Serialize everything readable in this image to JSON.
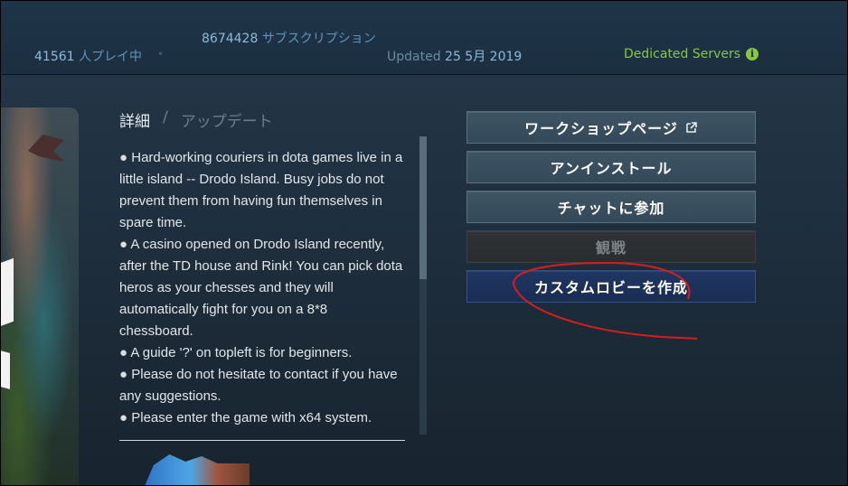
{
  "stats": {
    "players_count": "41561",
    "players_label": "人プレイ中",
    "separator": "•",
    "subscriptions_count": "8674428",
    "subscriptions_label": "サブスクリプション",
    "updated_label": "Updated",
    "updated_date": "25 5月 2019",
    "dedicated_servers": "Dedicated Servers",
    "info_glyph": "i"
  },
  "tabs": {
    "details": "詳細",
    "separator": "/",
    "updates": "アップデート"
  },
  "description": {
    "bullet": "●",
    "lines": [
      "Hard-working couriers in dota games live in a little island -- Drodo Island. Busy jobs do not prevent them from having fun themselves in spare time.",
      "A casino opened on Drodo Island recently, after the TD house and Rink! You can pick dota heros as your chesses and they will automatically fight for you on a 8*8 chessboard.",
      "A guide '?' on topleft is for beginners.",
      "Please do not hesitate to contact if you have any suggestions.",
      "Please enter the game with x64 system."
    ]
  },
  "buttons": {
    "workshop": "ワークショップページ",
    "uninstall": "アンインストール",
    "join_chat": "チャットに参加",
    "watch": "観戦",
    "create_lobby": "カスタムロビーを作成"
  },
  "icons": {
    "external_link": "external-link-icon",
    "info": "info-icon"
  },
  "colors": {
    "accent_green": "#8cc63f",
    "stat_blue": "#8fb9dc",
    "lobby_button": "#1f3663",
    "annotation_red": "#d91c1c"
  }
}
